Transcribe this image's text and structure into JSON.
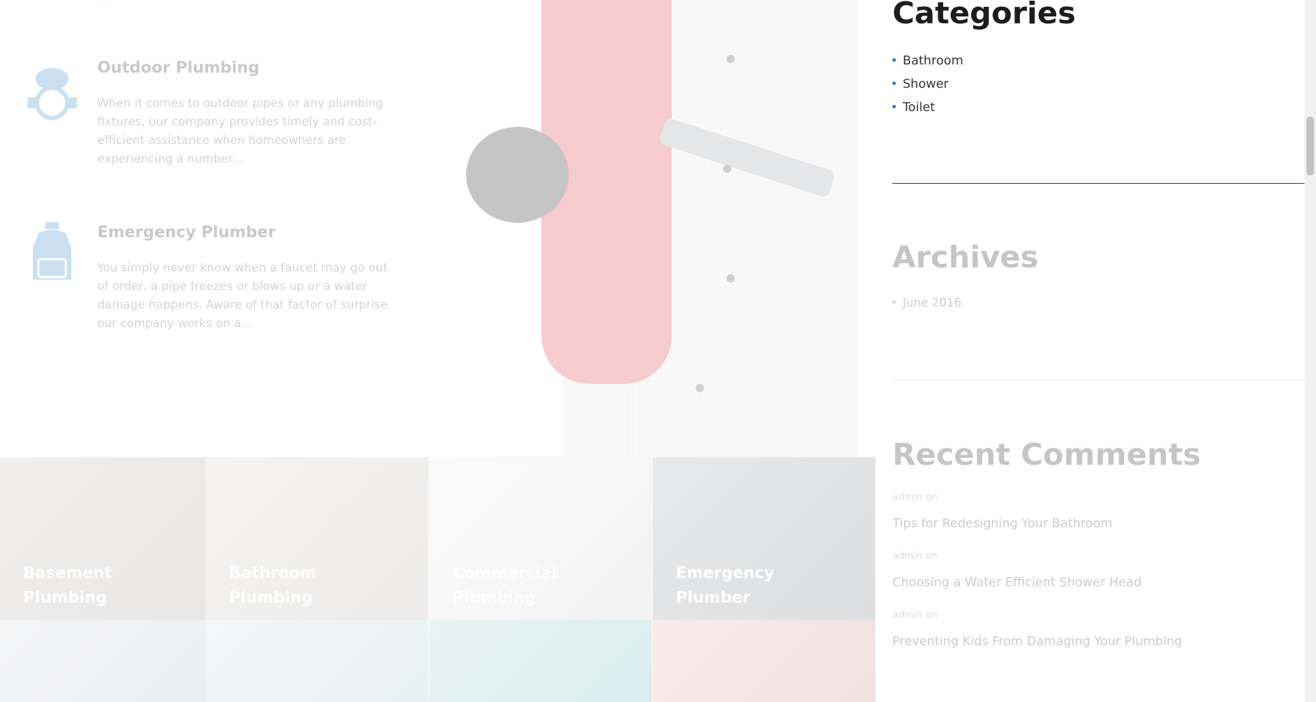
{
  "services": [
    {
      "title": "Outdoor Plumbing",
      "description": "When it comes to outdoor pipes or any plumbing fixtures, our company provides timely and cost-efficient assistance when homeowners are experiencing a number...",
      "icon": "faucet-handle-icon"
    },
    {
      "title": "Emergency Plumber",
      "description": "You simply never know when a faucet may go out of order, a pipe freezes or blows up or a water damage happens. Aware of that factor of surprise our company works on a...",
      "icon": "cleaner-bottle-icon"
    }
  ],
  "tiles": [
    {
      "label": "Basement Plumbing",
      "color": "#b9b4b0"
    },
    {
      "label": "Bathroom Plumbing",
      "color": "#c9c3bc"
    },
    {
      "label": "Commercial Plumbing",
      "color": "#e2e2e2"
    },
    {
      "label": "Emergency Plumber",
      "color": "#8e9299"
    },
    {
      "label": "",
      "color": "#c8ccd2"
    },
    {
      "label": "",
      "color": "#b9d3d6"
    },
    {
      "label": "",
      "color": "#8fc7cf"
    },
    {
      "label": "",
      "color": "#d6a79a"
    }
  ],
  "sidebar": {
    "categories": {
      "title": "Categories",
      "items": [
        "Bathroom",
        "Shower",
        "Toilet"
      ]
    },
    "archives": {
      "title": "Archives",
      "items": [
        "June 2016"
      ]
    },
    "recent_comments": {
      "title": "Recent Comments",
      "items": [
        {
          "author": "admin on",
          "post": "Tips for Redesigning Your Bathroom"
        },
        {
          "author": "admin on",
          "post": "Choosing a Water Efficient Shower Head"
        },
        {
          "author": "admin on",
          "post": "Preventing Kids From Damaging Your Plumbing"
        }
      ]
    }
  },
  "colors": {
    "accent": "#2a6fd6",
    "hose": "#d8343b"
  }
}
